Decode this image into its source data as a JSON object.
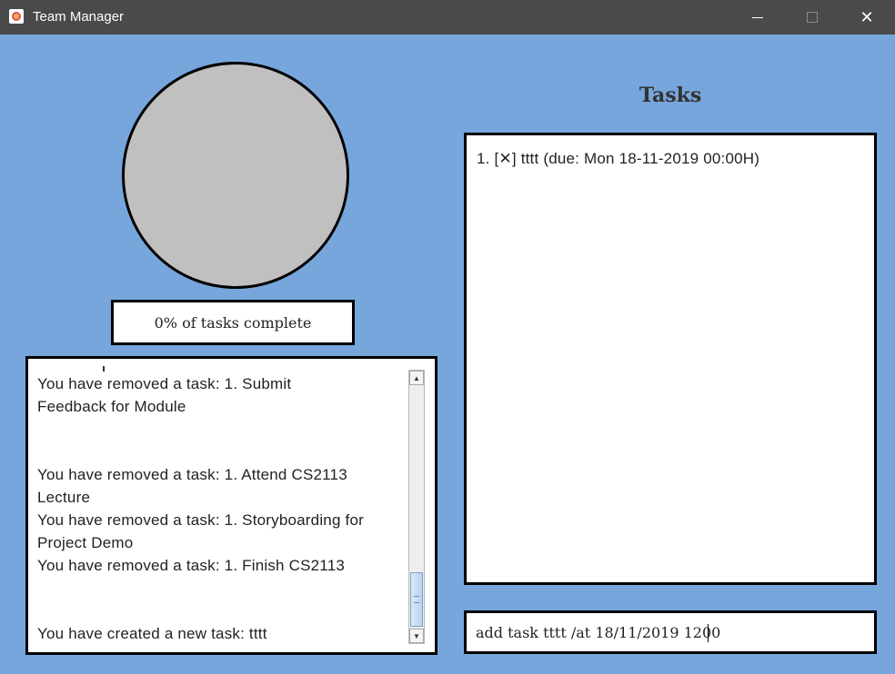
{
  "window": {
    "title": "Team Manager",
    "controls": {
      "minimize_icon": "minimize-icon",
      "maximize_icon": "maximize-icon",
      "close_icon": "close-icon",
      "close_glyph": "✕"
    }
  },
  "progress": {
    "label": "0% of tasks complete",
    "fraction_complete": 0
  },
  "log": {
    "lines": [
      "You have removed a task: 1. Submit",
      "Feedback for Module",
      "",
      "",
      "You have removed a task: 1. Attend CS2113",
      "Lecture",
      "You have removed a task: 1. Storyboarding for",
      "Project Demo",
      "You have removed a task: 1. Finish CS2113",
      "",
      "",
      "You have created a new task: tttt"
    ],
    "scroll_up_glyph": "▲",
    "scroll_down_glyph": "▼"
  },
  "tasks": {
    "heading": "Tasks",
    "items": [
      "1. [✕] tttt (due: Mon 18-11-2019 00:00H)"
    ]
  },
  "command": {
    "value": "add task tttt /at 18/11/2019 1200"
  },
  "colors": {
    "background": "#77a6dc",
    "titlebar": "#4a4a4a",
    "circle_fill": "#c0c0c0",
    "border": "#000000"
  }
}
